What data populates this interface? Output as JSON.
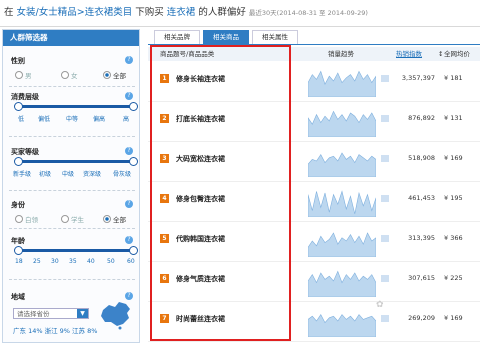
{
  "header": {
    "prefix": "在",
    "category": "女装/女士精品>连衣裙类目",
    "mid": "下购买",
    "keyword": "连衣裙",
    "suffix": "的人群偏好",
    "period": "最近30天(2014-08-31 至 2014-09-29)"
  },
  "sidebar": {
    "title": "人群筛选器",
    "help": "?",
    "gender": {
      "title": "性别",
      "options": [
        "男",
        "女",
        "全部"
      ],
      "selected": "全部"
    },
    "spend": {
      "title": "消费层级",
      "ticks": [
        "低",
        "偏低",
        "中等",
        "偏高",
        "高"
      ]
    },
    "buyer": {
      "title": "买家等级",
      "ticks": [
        "新手级",
        "初级",
        "中级",
        "资深级",
        "骨灰级"
      ]
    },
    "identity": {
      "title": "身份",
      "options": [
        "白领",
        "学生",
        "全部"
      ],
      "selected": "全部"
    },
    "age": {
      "title": "年龄",
      "ticks": [
        "18",
        "25",
        "30",
        "35",
        "40",
        "50",
        "60"
      ]
    },
    "region": {
      "title": "地域",
      "placeholder": "请选择省份",
      "stats": "广东 14%  浙江 9%  江苏 8%"
    }
  },
  "tabs": [
    "相关品牌",
    "相关商品",
    "相关属性"
  ],
  "active_tab": "相关商品",
  "table": {
    "headers": {
      "product": "商品题号/商品品类",
      "trend": "销量趋势",
      "hot": "热销指数",
      "price": "全网均价"
    },
    "rows": [
      {
        "rank": "1",
        "name": "修身长袖连衣裙",
        "hot": "3,357,397",
        "price": "¥ 181"
      },
      {
        "rank": "2",
        "name": "打底长袖连衣裙",
        "hot": "876,892",
        "price": "¥ 131"
      },
      {
        "rank": "3",
        "name": "大码宽松连衣裙",
        "hot": "518,908",
        "price": "¥ 169"
      },
      {
        "rank": "4",
        "name": "修身包臀连衣裙",
        "hot": "461,453",
        "price": "¥ 195"
      },
      {
        "rank": "5",
        "name": "代购韩国连衣裙",
        "hot": "313,395",
        "price": "¥ 366"
      },
      {
        "rank": "6",
        "name": "修身气质连衣裙",
        "hot": "307,615",
        "price": "¥ 225"
      },
      {
        "rank": "7",
        "name": "时尚蕾丝连衣裙",
        "hot": "269,209",
        "price": "¥ 169"
      }
    ]
  },
  "colors": {
    "accent": "#2f7dc3",
    "rank_badge": "#e8760e",
    "highlight_box": "#e02020",
    "link": "#1a6eb8"
  }
}
